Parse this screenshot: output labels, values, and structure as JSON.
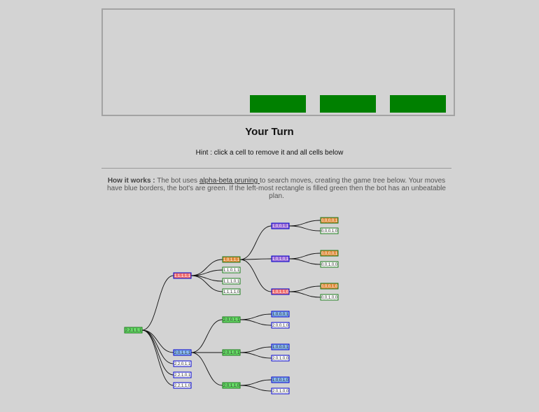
{
  "board": {
    "cells": [
      {
        "col": 0,
        "row": 0
      },
      {
        "col": 1,
        "row": 0
      },
      {
        "col": 2,
        "row": 0
      }
    ]
  },
  "status": "Your Turn",
  "hint": "Hint : click a cell to remove it and all cells below",
  "how_it_works": {
    "label": "How it works :",
    "text_before": " The bot uses ",
    "link": "alpha-beta pruning ",
    "text_after": "to search moves, creating the game tree below. Your moves have blue borders, the bot's are green. If the left-most rectangle is filled green then the bot has an unbeatable plan."
  },
  "colors": {
    "background": "#d3d3d3",
    "cell": "#008000",
    "user_border": "#0000cc",
    "bot_border": "#1a7a1a",
    "win_fill": "#66dd66",
    "lose_fill": "#f07070",
    "orange_fill": "#e08a3a",
    "purple_fill": "#9a6ad6",
    "blue_fill": "#88b8f0",
    "white_fill": "#ffffff"
  },
  "tree": {
    "nodes": [
      {
        "id": "root",
        "label": "2,2,1,1,1",
        "fill": "win",
        "border": "bot"
      },
      {
        "id": "a1",
        "label": "1,1,1,1,1",
        "fill": "lose",
        "border": "user"
      },
      {
        "id": "a2",
        "label": "2,0,1,1,1",
        "fill": "blue",
        "border": "user"
      },
      {
        "id": "a3",
        "label": "2,2,0,1,1",
        "fill": "white",
        "border": "user"
      },
      {
        "id": "a4",
        "label": "2,2,1,0,1",
        "fill": "white",
        "border": "user"
      },
      {
        "id": "a5",
        "label": "2,2,1,1,0",
        "fill": "white",
        "border": "user"
      },
      {
        "id": "b1",
        "label": "1,0,1,1,1",
        "fill": "orange",
        "border": "bot"
      },
      {
        "id": "b2",
        "label": "1,1,0,1,1",
        "fill": "white",
        "border": "bot"
      },
      {
        "id": "b3",
        "label": "1,1,1,0,1",
        "fill": "white",
        "border": "bot"
      },
      {
        "id": "b4",
        "label": "1,1,1,1,0",
        "fill": "white",
        "border": "bot"
      },
      {
        "id": "c1",
        "label": "1,0,0,1,1",
        "fill": "purple",
        "border": "user"
      },
      {
        "id": "c2",
        "label": "1,0,1,0,1",
        "fill": "purple",
        "border": "user"
      },
      {
        "id": "c3",
        "label": "1,0,1,1,0",
        "fill": "lose",
        "border": "user"
      },
      {
        "id": "d1",
        "label": "0,0,0,0,1",
        "fill": "orange",
        "border": "bot"
      },
      {
        "id": "d2",
        "label": "0,0,0,1,0",
        "fill": "white",
        "border": "bot"
      },
      {
        "id": "d3",
        "label": "0,0,0,0,1",
        "fill": "orange",
        "border": "bot"
      },
      {
        "id": "d4",
        "label": "0,0,1,0,0",
        "fill": "white",
        "border": "bot"
      },
      {
        "id": "d5",
        "label": "0,0,0,1,0",
        "fill": "orange",
        "border": "bot"
      },
      {
        "id": "d6",
        "label": "0,0,1,0,0",
        "fill": "white",
        "border": "bot"
      },
      {
        "id": "e1",
        "label": "2,0,0,1,1",
        "fill": "win",
        "border": "bot"
      },
      {
        "id": "e2",
        "label": "2,0,1,0,1",
        "fill": "win",
        "border": "bot"
      },
      {
        "id": "e3",
        "label": "2,0,1,1,0",
        "fill": "win",
        "border": "bot"
      },
      {
        "id": "f1",
        "label": "1,0,0,0,1",
        "fill": "blue",
        "border": "user"
      },
      {
        "id": "f2",
        "label": "2,0,0,1,0",
        "fill": "white",
        "border": "user"
      },
      {
        "id": "f3",
        "label": "1,0,0,0,1",
        "fill": "blue",
        "border": "user"
      },
      {
        "id": "f4",
        "label": "2,0,1,0,0",
        "fill": "white",
        "border": "user"
      },
      {
        "id": "f5",
        "label": "1,0,0,1,0",
        "fill": "blue",
        "border": "user"
      },
      {
        "id": "f6",
        "label": "2,0,1,0,0",
        "fill": "white",
        "border": "user"
      }
    ],
    "edges": [
      [
        "root",
        "a1"
      ],
      [
        "root",
        "a2"
      ],
      [
        "root",
        "a3"
      ],
      [
        "root",
        "a4"
      ],
      [
        "root",
        "a5"
      ],
      [
        "a1",
        "b1"
      ],
      [
        "a1",
        "b2"
      ],
      [
        "a1",
        "b3"
      ],
      [
        "a1",
        "b4"
      ],
      [
        "b1",
        "c1"
      ],
      [
        "b1",
        "c2"
      ],
      [
        "b1",
        "c3"
      ],
      [
        "c1",
        "d1"
      ],
      [
        "c1",
        "d2"
      ],
      [
        "c2",
        "d3"
      ],
      [
        "c2",
        "d4"
      ],
      [
        "c3",
        "d5"
      ],
      [
        "c3",
        "d6"
      ],
      [
        "a2",
        "e1"
      ],
      [
        "a2",
        "e2"
      ],
      [
        "a2",
        "e3"
      ],
      [
        "e1",
        "f1"
      ],
      [
        "e1",
        "f2"
      ],
      [
        "e2",
        "f3"
      ],
      [
        "e2",
        "f4"
      ],
      [
        "e3",
        "f5"
      ],
      [
        "e3",
        "f6"
      ]
    ]
  }
}
